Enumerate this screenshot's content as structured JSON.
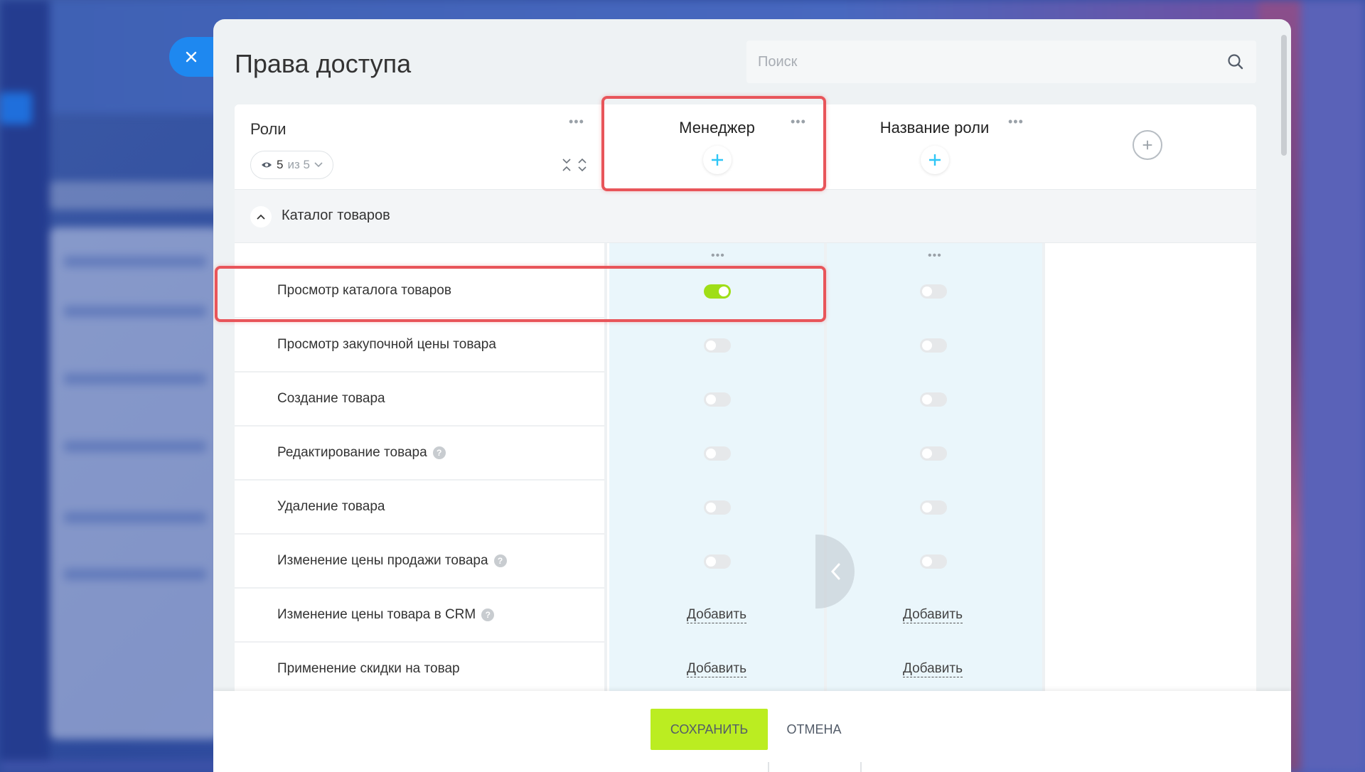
{
  "panel": {
    "title": "Права доступа",
    "search_placeholder": "Поиск"
  },
  "roles_header": {
    "label": "Роли",
    "counter_shown": "5",
    "counter_total": "из 5"
  },
  "roles": [
    {
      "name": "Менеджер"
    },
    {
      "name": "Название роли"
    }
  ],
  "section": {
    "title": "Каталог товаров"
  },
  "permissions": [
    {
      "label": "Просмотр каталога товаров",
      "help": false,
      "kind": "toggle",
      "values": [
        true,
        false
      ]
    },
    {
      "label": "Просмотр закупочной цены товара",
      "help": false,
      "kind": "toggle",
      "values": [
        false,
        false
      ]
    },
    {
      "label": "Создание товара",
      "help": false,
      "kind": "toggle",
      "values": [
        false,
        false
      ]
    },
    {
      "label": "Редактирование товара",
      "help": true,
      "kind": "toggle",
      "values": [
        false,
        false
      ]
    },
    {
      "label": "Удаление товара",
      "help": false,
      "kind": "toggle",
      "values": [
        false,
        false
      ]
    },
    {
      "label": "Изменение цены продажи товара",
      "help": true,
      "kind": "toggle",
      "values": [
        false,
        false
      ]
    },
    {
      "label": "Изменение цены товара в CRM",
      "help": true,
      "kind": "add",
      "values": [
        "Добавить",
        "Добавить"
      ]
    },
    {
      "label": "Применение скидки на товар",
      "help": false,
      "kind": "add",
      "values": [
        "Добавить",
        "Добавить"
      ]
    }
  ],
  "footer": {
    "save_label": "СОХРАНИТЬ",
    "cancel_label": "ОТМЕНА"
  },
  "colors": {
    "accent_green": "#bbed21",
    "toggle_on": "#9fde17",
    "highlight": "#e8555a",
    "close_blue": "#1e88f0",
    "column_tint": "#eaf6fb"
  }
}
